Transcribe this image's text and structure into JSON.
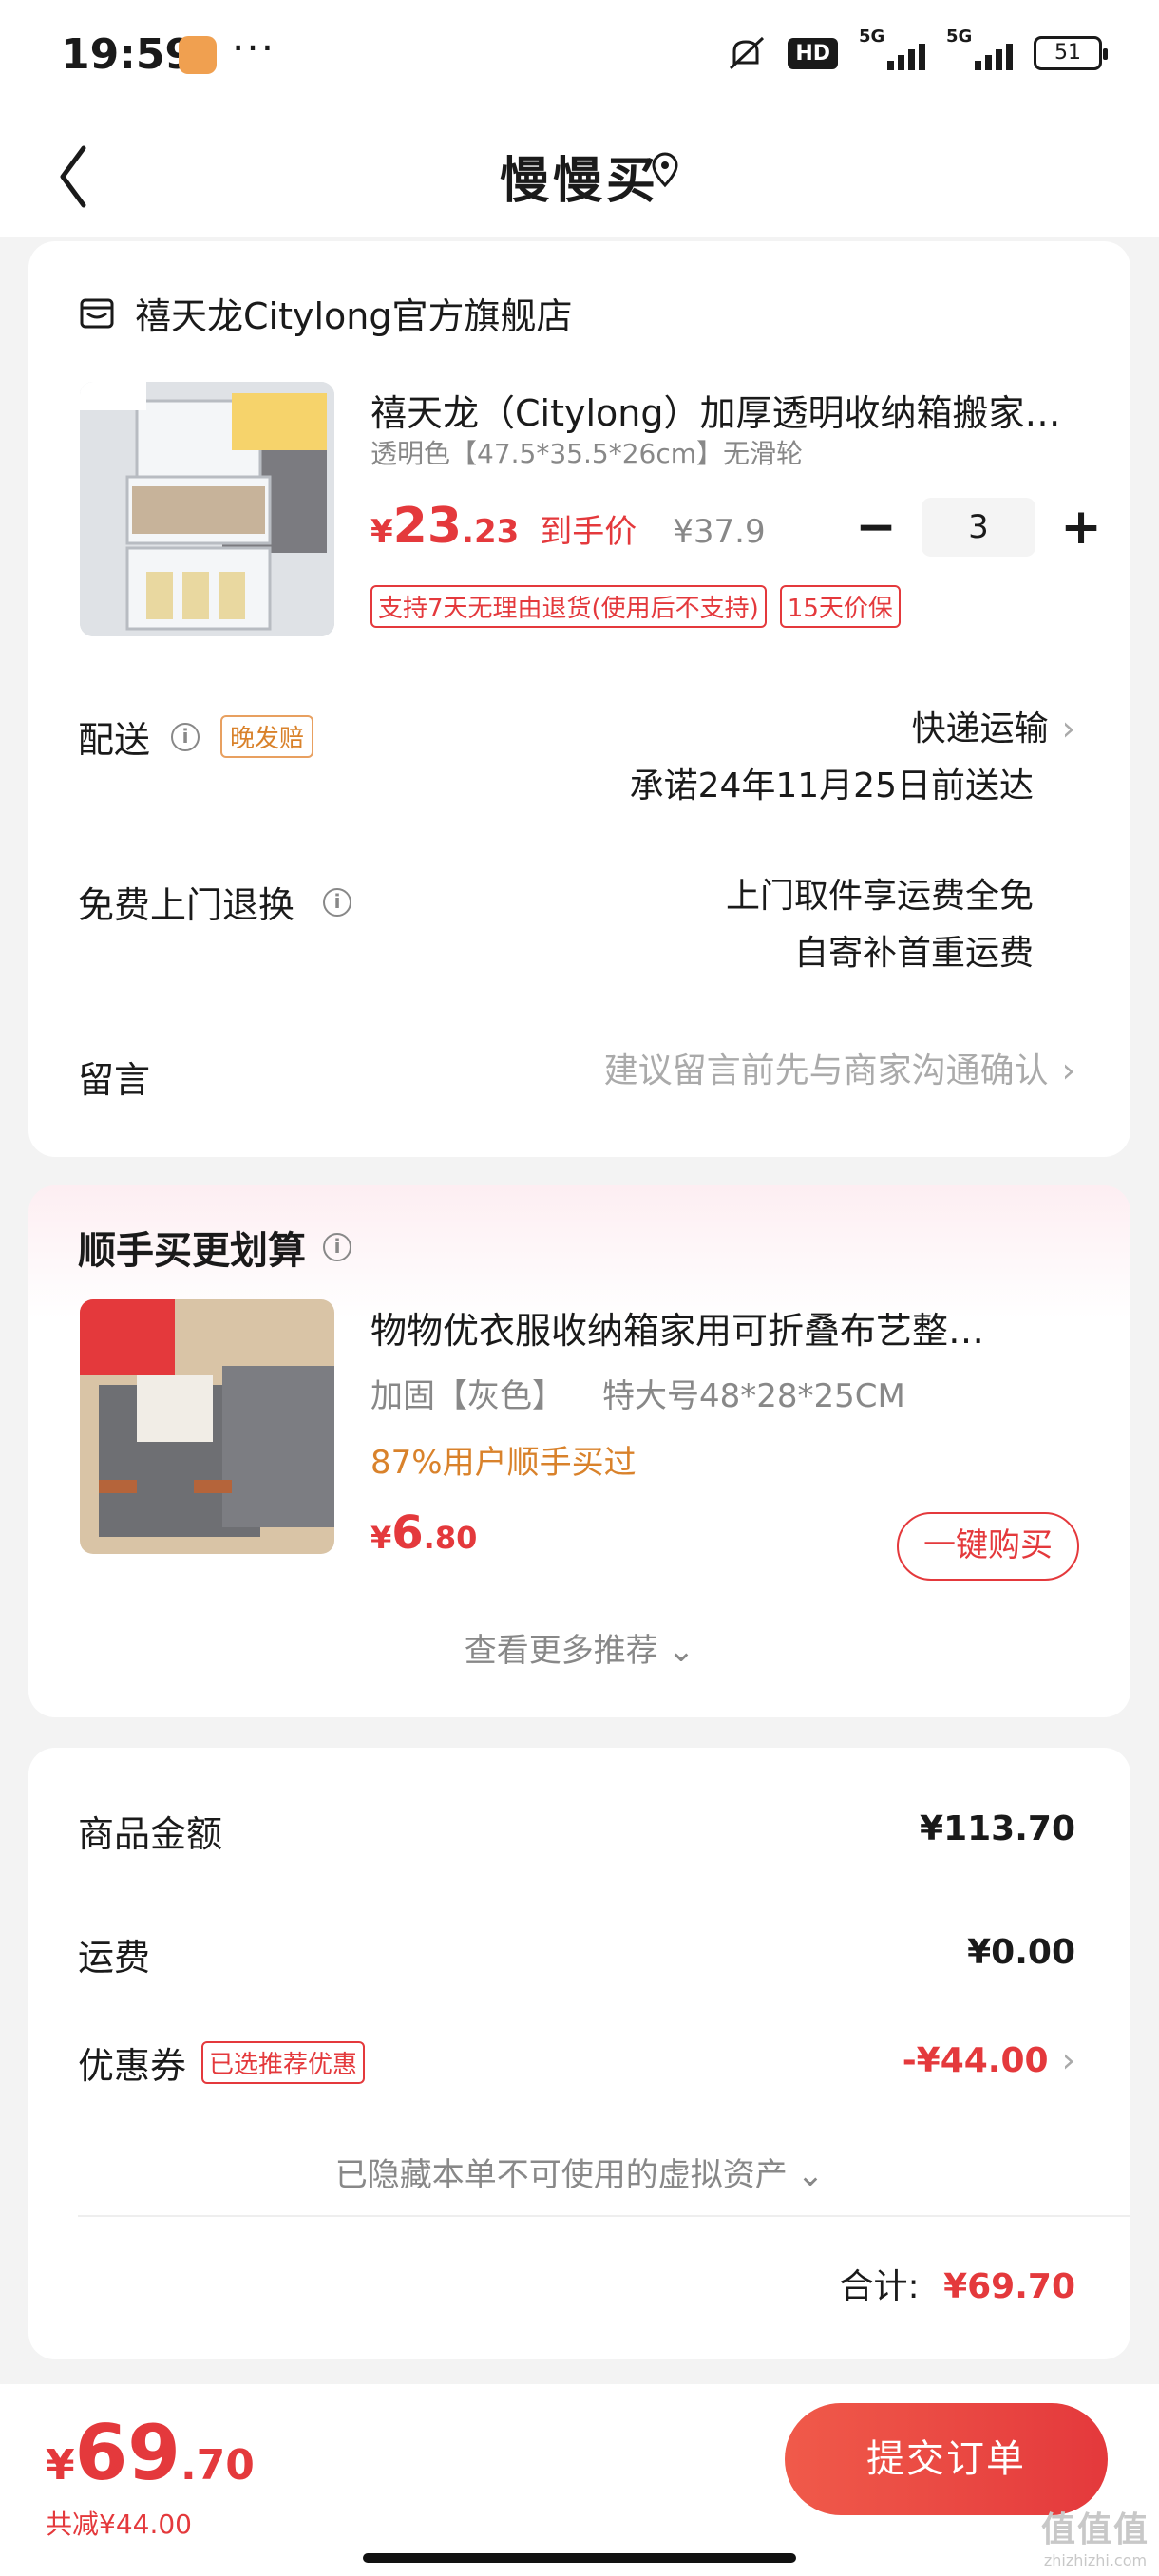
{
  "status_bar": {
    "time": "19:59",
    "dots": "···",
    "hd": "HD",
    "net1": "5G",
    "net2": "5G",
    "battery": "51"
  },
  "header": {
    "title": "慢慢买"
  },
  "order": {
    "store_name": "禧天龙Citylong官方旗舰店",
    "product": {
      "title": "禧天龙（Citylong）加厚透明收纳箱搬家…",
      "spec": "透明色【47.5*35.5*26cm】无滑轮",
      "price_symbol": "¥",
      "price_int": "23",
      "price_dec": ".23",
      "price_label": "到手价",
      "orig_price": "¥37.9",
      "quantity": "3",
      "tags": [
        "支持7天无理由退货(使用后不支持)",
        "15天价保"
      ]
    },
    "delivery": {
      "label": "配送",
      "badge": "晚发赔",
      "method": "快递运输",
      "promise": "承诺24年11月25日前送达"
    },
    "return": {
      "label": "免费上门退换",
      "line1": "上门取件享运费全免",
      "line2": "自寄补首重运费"
    },
    "message": {
      "label": "留言",
      "placeholder": "建议留言前先与商家沟通确认"
    }
  },
  "recommend": {
    "title": "顺手买更划算",
    "product_title": "物物优衣服收纳箱家用可折叠布艺整…",
    "spec1": "加固【灰色】",
    "spec2": "特大号48*28*25CM",
    "social": "87%用户顺手买过",
    "price_symbol": "¥",
    "price_int": "6",
    "price_dec": ".80",
    "buy_label": "一键购买",
    "more_label": "查看更多推荐"
  },
  "summary": {
    "goods_label": "商品金额",
    "goods_value": "¥113.70",
    "shipping_label": "运费",
    "shipping_value": "¥0.00",
    "coupon_label": "优惠券",
    "coupon_badge": "已选推荐优惠",
    "coupon_value": "-¥44.00",
    "hidden_assets": "已隐藏本单不可使用的虚拟资产",
    "total_label": "合计:",
    "total_value": "¥69.70"
  },
  "bottom": {
    "price_symbol": "¥",
    "price_int": "69",
    "price_dec": ".70",
    "discount": "共减¥44.00",
    "submit_label": "提交订单"
  },
  "watermark": {
    "cn": "值值值",
    "en": "zhizhizhi.com"
  },
  "colors": {
    "accent": "#e4393c",
    "orange": "#d9822b",
    "background": "#f3f3f3"
  }
}
